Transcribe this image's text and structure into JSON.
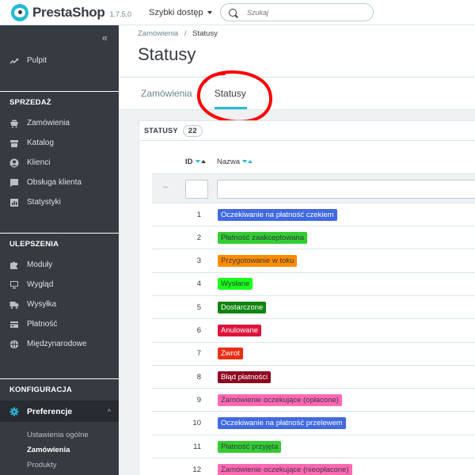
{
  "header": {
    "brand": "PrestaShop",
    "version": "1.7.5.0",
    "quick_access": "Szybki dostęp",
    "search_placeholder": "Szukaj"
  },
  "sidebar": {
    "collapse_glyph": "«",
    "dashboard": "Pulpit",
    "sections": {
      "sell": "SPRZEDAŻ",
      "improve": "ULEPSZENIA",
      "configure": "KONFIGURACJA"
    },
    "sell_items": [
      {
        "label": "Zamówienia",
        "icon": "cart-icon"
      },
      {
        "label": "Katalog",
        "icon": "store-icon"
      },
      {
        "label": "Klienci",
        "icon": "user-icon"
      },
      {
        "label": "Obsługa klienta",
        "icon": "chat-icon"
      },
      {
        "label": "Statystyki",
        "icon": "chart-icon"
      }
    ],
    "improve_items": [
      {
        "label": "Moduły",
        "icon": "puzzle-icon"
      },
      {
        "label": "Wygląd",
        "icon": "monitor-icon"
      },
      {
        "label": "Wysyłka",
        "icon": "truck-icon"
      },
      {
        "label": "Płatność",
        "icon": "card-icon"
      },
      {
        "label": "Międzynarodowe",
        "icon": "globe-icon"
      }
    ],
    "configure_active": {
      "label": "Preferencje",
      "icon": "gear-icon",
      "chevron": "^"
    },
    "sub_items": [
      "Ustawienia ogólne",
      "Zamówienia",
      "Produkty"
    ]
  },
  "breadcrumb": {
    "parent": "Zamówienia",
    "separator": "/",
    "current": "Statusy"
  },
  "page_title": "Statusy",
  "tabs": [
    "Zamówienia",
    "Statusy"
  ],
  "active_tab": "Statusy",
  "panel": {
    "title": "STATUSY",
    "count": "22",
    "columns": {
      "id": "ID",
      "name": "Nazwa"
    },
    "filter_placeholder": "--"
  },
  "statuses": [
    {
      "id": "1",
      "name": "Oczekiwanie na płatność czekiem",
      "color": "#4169e1",
      "text_color": "#ffffff"
    },
    {
      "id": "2",
      "name": "Płatność zaakceptowana",
      "color": "#32cd32",
      "text_color": "#363a41"
    },
    {
      "id": "3",
      "name": "Przygotowanie w toku",
      "color": "#ff8c00",
      "text_color": "#363a41"
    },
    {
      "id": "4",
      "name": "Wysłane",
      "color": "#1aff1a",
      "text_color": "#363a41"
    },
    {
      "id": "5",
      "name": "Dostarczone",
      "color": "#108510",
      "text_color": "#ffffff"
    },
    {
      "id": "6",
      "name": "Anulowane",
      "color": "#dc143c",
      "text_color": "#ffffff"
    },
    {
      "id": "7",
      "name": "Zwrot",
      "color": "#ec2e15",
      "text_color": "#ffffff"
    },
    {
      "id": "8",
      "name": "Błąd płatności",
      "color": "#8f0621",
      "text_color": "#ffffff"
    },
    {
      "id": "9",
      "name": "Zamówienie oczekujące (opłacone)",
      "color": "#ff69b4",
      "text_color": "#363a41"
    },
    {
      "id": "10",
      "name": "Oczekiwanie na płatność przelewem",
      "color": "#4169e1",
      "text_color": "#ffffff"
    },
    {
      "id": "11",
      "name": "Płatność przyjęta",
      "color": "#32cd32",
      "text_color": "#363a41"
    },
    {
      "id": "12",
      "name": "Zamówienie oczekujące (nieopłacone)",
      "color": "#ff69b4",
      "text_color": "#363a41"
    }
  ],
  "colors": {
    "accent": "#25b9d7",
    "sidebar_bg": "#363a41",
    "annotation": "#ff0000"
  }
}
